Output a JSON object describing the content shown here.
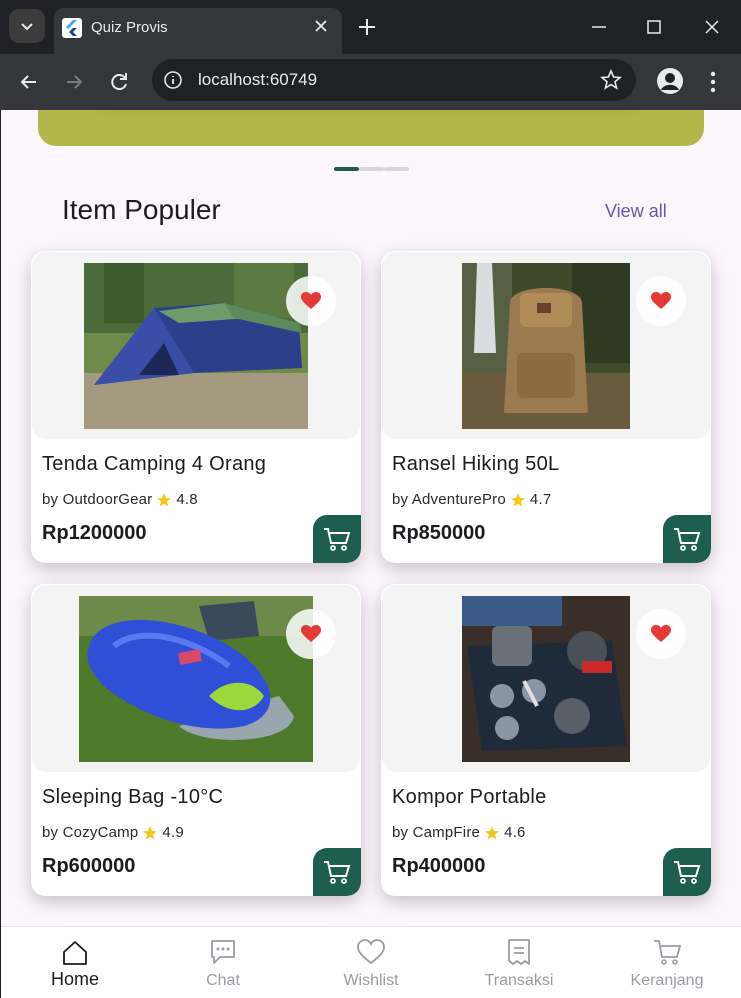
{
  "browser": {
    "tab_title": "Quiz Provis",
    "url": "localhost:60749"
  },
  "page": {
    "section_title": "Item Populer",
    "view_all": "View all",
    "carousel": {
      "count": 3,
      "active_index": 0
    },
    "accent_color": "#1d5e51",
    "products": [
      {
        "name": "Tenda Camping 4 Orang",
        "by": "by OutdoorGear",
        "rating": "4.8",
        "price": "Rp1200000",
        "image": "tent-photo"
      },
      {
        "name": "Ransel Hiking 50L",
        "by": "by AdventurePro",
        "rating": "4.7",
        "price": "Rp850000",
        "image": "backpack-photo"
      },
      {
        "name": "Sleeping Bag -10°C",
        "by": "by CozyCamp",
        "rating": "4.9",
        "price": "Rp600000",
        "image": "sleeping-bag-photo"
      },
      {
        "name": "Kompor Portable",
        "by": "by CampFire",
        "rating": "4.6",
        "price": "Rp400000",
        "image": "cooking-set-photo"
      }
    ]
  },
  "bottom_nav": [
    {
      "label": "Home",
      "icon": "home-icon",
      "active": true
    },
    {
      "label": "Chat",
      "icon": "chat-icon",
      "active": false
    },
    {
      "label": "Wishlist",
      "icon": "heart-icon",
      "active": false
    },
    {
      "label": "Transaksi",
      "icon": "receipt-icon",
      "active": false
    },
    {
      "label": "Keranjang",
      "icon": "cart-icon",
      "active": false
    }
  ]
}
